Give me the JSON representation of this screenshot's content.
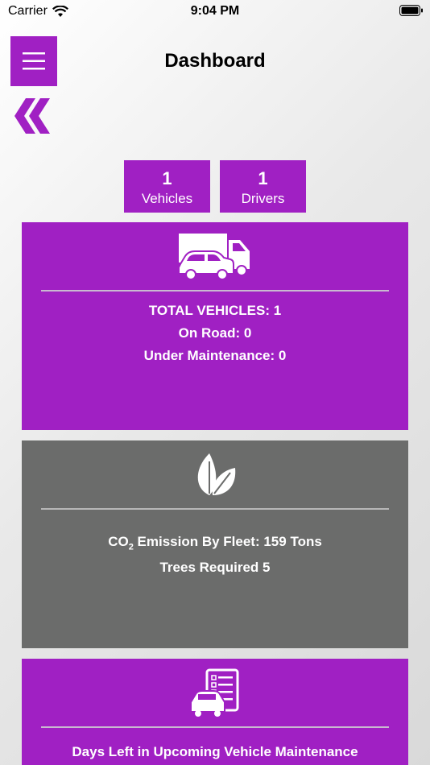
{
  "status_bar": {
    "carrier": "Carrier",
    "time": "9:04 PM"
  },
  "header": {
    "title": "Dashboard"
  },
  "stats": {
    "vehicles": {
      "count": "1",
      "label": "Vehicles"
    },
    "drivers": {
      "count": "1",
      "label": "Drivers"
    }
  },
  "vehicles_card": {
    "icon": "vehicles-icon",
    "total": "TOTAL VEHICLES: 1",
    "on_road": "On Road:  0",
    "maintenance": "Under Maintenance:  0"
  },
  "emission_card": {
    "icon": "leaf-icon",
    "co2_prefix": "CO",
    "co2_sub": "2",
    "co2_suffix": " Emission By Fleet: 159 Tons",
    "trees": "Trees Required 5"
  },
  "maintenance_card": {
    "icon": "maintenance-checklist-icon",
    "title": "Days Left in Upcoming Vehicle Maintenance"
  },
  "colors": {
    "accent": "#a020c3",
    "gray_card": "#6b6c6b"
  }
}
